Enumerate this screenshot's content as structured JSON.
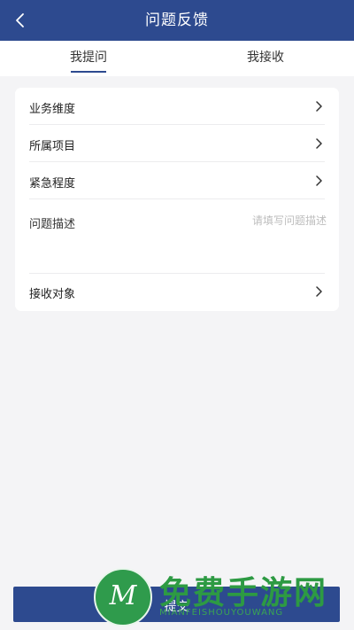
{
  "header": {
    "title": "问题反馈",
    "back_icon": "chevron-left-icon"
  },
  "tabs": [
    {
      "label": "我提问",
      "active": true
    },
    {
      "label": "我接收",
      "active": false
    }
  ],
  "form": {
    "rows": [
      {
        "label": "业务维度"
      },
      {
        "label": "所属项目"
      },
      {
        "label": "紧急程度"
      }
    ],
    "description": {
      "label": "问题描述",
      "placeholder": "请填写问题描述"
    },
    "recipient": {
      "label": "接收对象"
    }
  },
  "submit_label": "提交",
  "watermark": {
    "main": "免费手游网",
    "sub": "MIANFEISHOUYOUWANG"
  },
  "colors": {
    "primary": "#2d4a8f",
    "watermark": "#2d9a43"
  }
}
